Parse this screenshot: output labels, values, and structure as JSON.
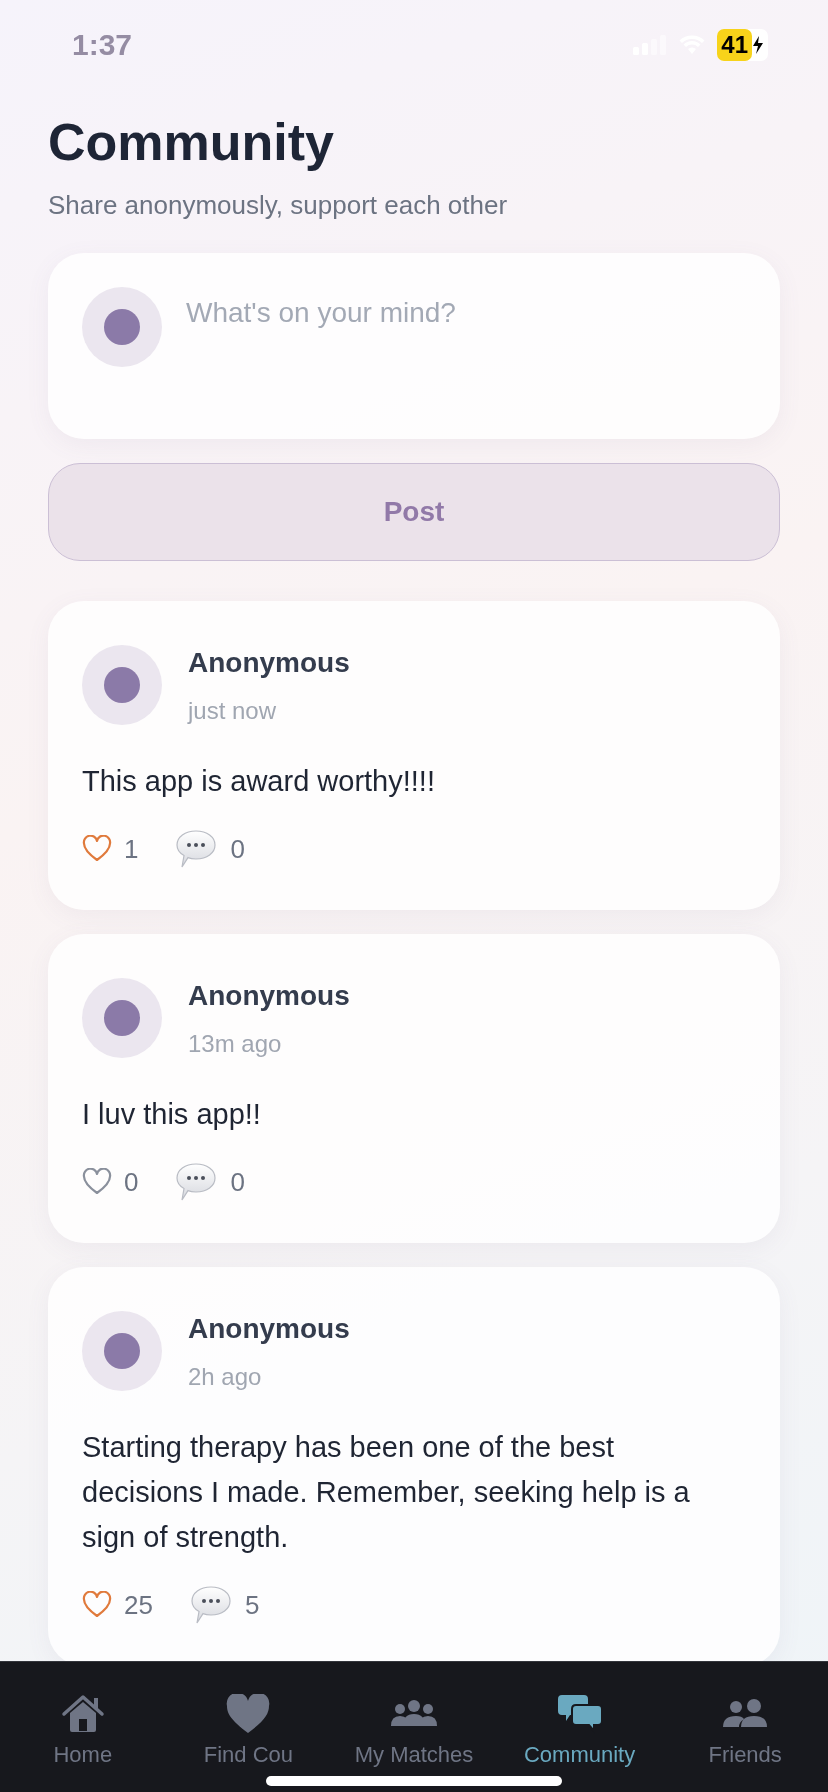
{
  "status_bar": {
    "time": "1:37",
    "battery": "41"
  },
  "header": {
    "title": "Community",
    "subtitle": "Share anonymously, support each other"
  },
  "composer": {
    "placeholder": "What's on your mind?"
  },
  "post_button": {
    "label": "Post",
    "disabled": true
  },
  "posts": [
    {
      "author": "Anonymous",
      "time": "just now",
      "text": "This app is award worthy!!!!",
      "liked": true,
      "likes": "1",
      "comments": "0"
    },
    {
      "author": "Anonymous",
      "time": "13m ago",
      "text": "I luv this app!!",
      "liked": false,
      "likes": "0",
      "comments": "0"
    },
    {
      "author": "Anonymous",
      "time": "2h ago",
      "text": "Starting therapy has been one of the best decisions I made. Remember, seeking help is a sign of strength.",
      "liked": true,
      "likes": "25",
      "comments": "5"
    }
  ],
  "tabs": [
    {
      "kind": "home",
      "label": "Home",
      "selected": false
    },
    {
      "kind": "heart",
      "label": "Find Cou",
      "selected": false
    },
    {
      "kind": "group",
      "label": "My Matches",
      "selected": false
    },
    {
      "kind": "chat",
      "label": "Community",
      "selected": true
    },
    {
      "kind": "people",
      "label": "Friends",
      "selected": false
    }
  ]
}
